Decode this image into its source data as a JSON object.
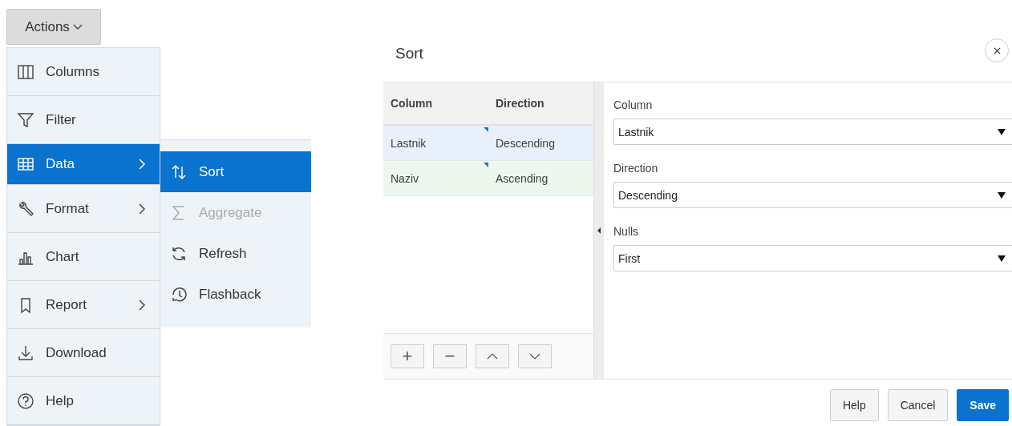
{
  "actions_button": {
    "label": "Actions"
  },
  "menu": {
    "items": [
      {
        "label": "Columns",
        "selected": false,
        "has_submenu": false
      },
      {
        "label": "Filter",
        "selected": false,
        "has_submenu": false
      },
      {
        "label": "Data",
        "selected": true,
        "has_submenu": true
      },
      {
        "label": "Format",
        "selected": false,
        "has_submenu": true
      },
      {
        "label": "Chart",
        "selected": false,
        "has_submenu": false
      },
      {
        "label": "Report",
        "selected": false,
        "has_submenu": true
      },
      {
        "label": "Download",
        "selected": false,
        "has_submenu": false
      },
      {
        "label": "Help",
        "selected": false,
        "has_submenu": false
      }
    ]
  },
  "submenu": {
    "items": [
      {
        "label": "Sort",
        "selected": true,
        "disabled": false
      },
      {
        "label": "Aggregate",
        "selected": false,
        "disabled": true
      },
      {
        "label": "Refresh",
        "selected": false,
        "disabled": false
      },
      {
        "label": "Flashback",
        "selected": false,
        "disabled": false
      }
    ]
  },
  "dialog": {
    "title": "Sort",
    "table": {
      "columns": [
        "Column",
        "Direction"
      ],
      "rows": [
        {
          "cells": [
            "Lastnik",
            "Descending"
          ],
          "selected": true
        },
        {
          "cells": [
            "Naziv",
            "Ascending"
          ],
          "selected": false
        }
      ]
    },
    "toolbar": [
      "+",
      "−"
    ],
    "form": [
      {
        "label": "Column",
        "value": "Lastnik"
      },
      {
        "label": "Direction",
        "value": "Descending"
      },
      {
        "label": "Nulls",
        "value": "First"
      }
    ],
    "buttons": [
      {
        "label": "Help",
        "kind": "plain"
      },
      {
        "label": "Cancel",
        "kind": "plain"
      },
      {
        "label": "Save",
        "kind": "primary"
      }
    ]
  }
}
